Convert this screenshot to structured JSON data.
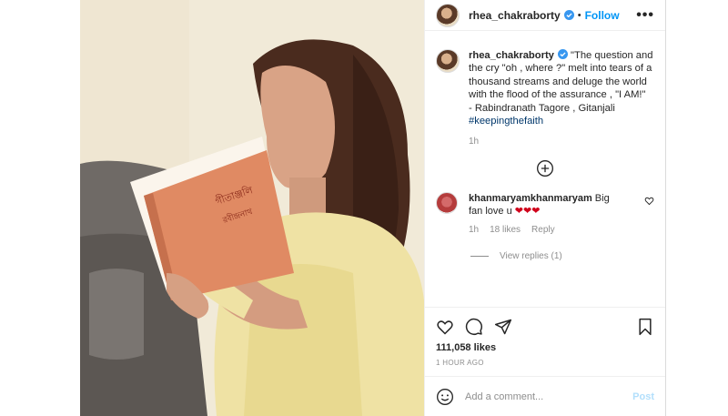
{
  "header": {
    "username": "rhea_chakraborty",
    "separator": "•",
    "follow_label": "Follow",
    "more_label": "•••"
  },
  "caption": {
    "username": "rhea_chakraborty",
    "text": " \"The question and the cry \"oh , where ?\" melt into tears of a thousand streams and deluge the world with the flood of the assurance , \"I AM!\"",
    "attribution": "- Rabindranath Tagore , Gitanjali",
    "hashtag": "#keepingthefaith",
    "time": "1h"
  },
  "book": {
    "title": "গীতাঞ্জলি",
    "subtitle": "রবীন্দ্রনাথ"
  },
  "comments": [
    {
      "username": "khanmaryamkhanmaryam",
      "text": " Big fan love u ",
      "emoji": "❤❤❤",
      "time": "1h",
      "likes": "18 likes",
      "reply_label": "Reply",
      "view_replies": "View replies (1)"
    }
  ],
  "post": {
    "likes": "111,058 likes",
    "time_ago": "1 HOUR AGO"
  },
  "add_comment": {
    "placeholder": "Add a comment...",
    "post_label": "Post"
  },
  "colors": {
    "accent": "#0095f6",
    "hashtag": "#00376b",
    "muted": "#8e8e8e",
    "post_disabled": "#b2dffc",
    "emoji_heart": "#d0021b"
  },
  "icons": [
    "verified-badge-icon",
    "more-options-icon",
    "add-comments-icon",
    "heart-icon",
    "comment-icon",
    "share-icon",
    "bookmark-icon",
    "emoji-icon"
  ]
}
